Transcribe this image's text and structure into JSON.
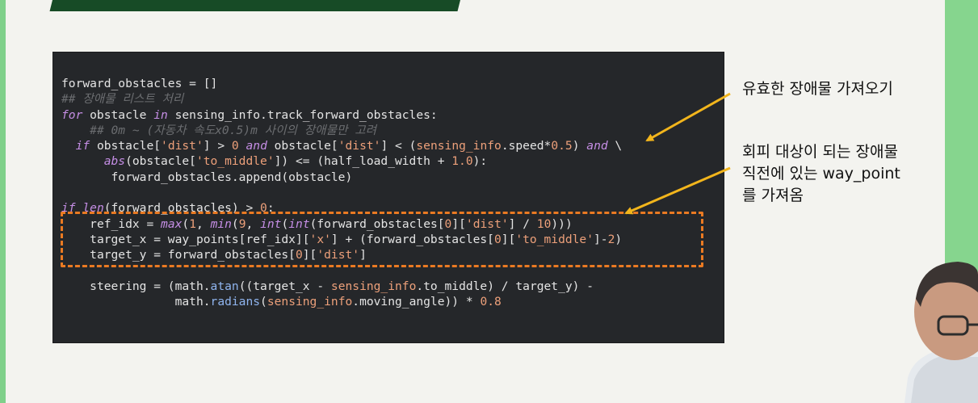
{
  "colors": {
    "slide_bg": "#f3f3ef",
    "side_accent": "#86d58e",
    "title_bar": "#174b26",
    "code_bg": "#25272a",
    "highlight_box": "#ea7a22",
    "arrow": "#f2b51c"
  },
  "code": {
    "l1": "forward_obstacles = []",
    "l2": "## 장애물 리스트 처리",
    "l3": {
      "k1": "for",
      "t1": " obstacle ",
      "k2": "in",
      "t2": " sensing_info.track_forward_obstacles:"
    },
    "l4": "## 0m ~ (자동차 속도x0.5)m 사이의 장애물만 고려",
    "l5": {
      "k1": "if",
      "t1": " obstacle[",
      "s1": "'dist'",
      "t2": "] > ",
      "n1": "0",
      "t3": " ",
      "k2": "and",
      "t4": " obstacle[",
      "s2": "'dist'",
      "t5": "] < (",
      "b1": "sensing_info",
      "t6": ".speed*",
      "n2": "0.5",
      "t7": ") ",
      "k3": "and",
      "t8": " \\"
    },
    "l6": {
      "k1": "abs",
      "t1": "(obstacle[",
      "s1": "'to_middle'",
      "t2": "]) <= (half_load_width + ",
      "n1": "1.0",
      "t3": "):"
    },
    "l7": "forward_obstacles.append(obstacle)",
    "l8": {
      "k1": "if",
      "t1": " ",
      "k2": "len",
      "t2": "(forward_obstacles) > ",
      "n1": "0",
      "t3": ":"
    },
    "l9": {
      "t1": "ref_idx = ",
      "k1": "max",
      "t2": "(",
      "n1": "1",
      "t3": ", ",
      "k2": "min",
      "t4": "(",
      "n2": "9",
      "t5": ", ",
      "k3": "int",
      "t6": "(",
      "k4": "int",
      "t7": "(forward_obstacles[",
      "n3": "0",
      "t8": "][",
      "s1": "'dist'",
      "t9": "] / ",
      "n4": "10",
      "t10": ")))"
    },
    "l10": {
      "t1": "target_x = way_points[ref_idx][",
      "s1": "'x'",
      "t2": "] + (forward_obstacles[",
      "n1": "0",
      "t3": "][",
      "s2": "'to_middle'",
      "t4": "]-",
      "n2": "2",
      "t5": ")"
    },
    "l11": {
      "t1": "target_y = forward_obstacles[",
      "n1": "0",
      "t2": "][",
      "s1": "'dist'",
      "t3": "]"
    },
    "l12": {
      "t1": "steering = (math.",
      "b1": "atan",
      "t2": "((target_x - ",
      "b2": "sensing_info",
      "t3": ".to_middle) / target_y) -"
    },
    "l13": {
      "t1": "math.",
      "b1": "radians",
      "t2": "(",
      "b2": "sensing_info",
      "t3": ".moving_angle)) * ",
      "n1": "0.8"
    }
  },
  "annotations": {
    "first": "유효한 장애물 가져오기",
    "second_line1": "회피 대상이 되는 장애물",
    "second_line2": "직전에 있는 way_point",
    "second_line3": "를 가져옴"
  }
}
